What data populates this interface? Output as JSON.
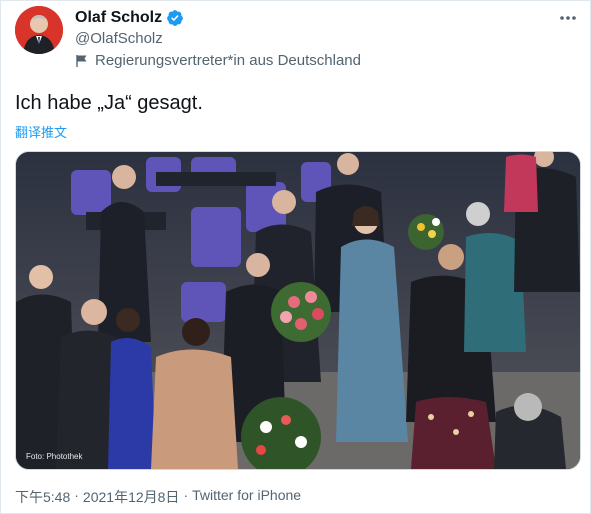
{
  "header": {
    "display_name": "Olaf Scholz",
    "handle": "@OlafScholz",
    "gov_label": "Regierungsvertreter*in aus Deutschland",
    "avatar_icon": "profile-photo",
    "verified_icon": "verified-badge-icon",
    "more_icon": "more-dots-icon",
    "flag_icon": "flag-icon",
    "verified_color": "#1d9bf0"
  },
  "tweet": {
    "text": "Ich habe „Ja“ gesagt.",
    "translate_label": "翻译推文"
  },
  "media": {
    "photo_credit": "Foto: Photothek"
  },
  "footer": {
    "time": "下午5:48",
    "separator": "·",
    "date": "2021年12月8日",
    "source": "Twitter for iPhone"
  },
  "colors": {
    "link": "#1d9bf0",
    "secondary_text": "#536471",
    "primary_text": "#0f1419"
  }
}
